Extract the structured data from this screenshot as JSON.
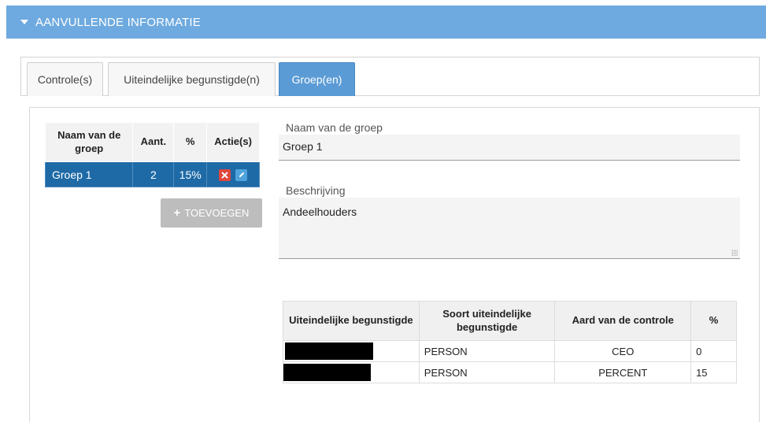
{
  "section": {
    "title": "AANVULLENDE INFORMATIE"
  },
  "tabs": [
    {
      "label": "Controle(s)",
      "active": false
    },
    {
      "label": "Uiteindelijke begunstigde(n)",
      "active": false
    },
    {
      "label": "Groep(en)",
      "active": true
    }
  ],
  "groups_table": {
    "headers": {
      "name": "Naam van de groep",
      "count": "Aant.",
      "pct": "%",
      "actions": "Actie(s)"
    },
    "rows": [
      {
        "name": "Groep 1",
        "count": "2",
        "pct": "15%"
      }
    ]
  },
  "add_button": {
    "label": "TOEVOEGEN"
  },
  "form": {
    "name_label": "Naam van de groep",
    "name_value": "Groep 1",
    "desc_label": "Beschrijving",
    "desc_value": "Andeelhouders"
  },
  "beneficiaries_table": {
    "headers": {
      "beneficiary": "Uiteindelijke begunstigde",
      "type": "Soort uiteindelijke begunstigde",
      "control": "Aard van de controle",
      "pct": "%"
    },
    "rows": [
      {
        "type": "PERSON",
        "control": "CEO",
        "pct": "0"
      },
      {
        "type": "PERSON",
        "control": "PERCENT",
        "pct": "15"
      }
    ]
  },
  "colors": {
    "header": "#6eaadf",
    "active_tab": "#5b9bd5",
    "selected_row": "#1e6aa6",
    "delete": "#e0453b",
    "edit": "#4ea3dc"
  }
}
